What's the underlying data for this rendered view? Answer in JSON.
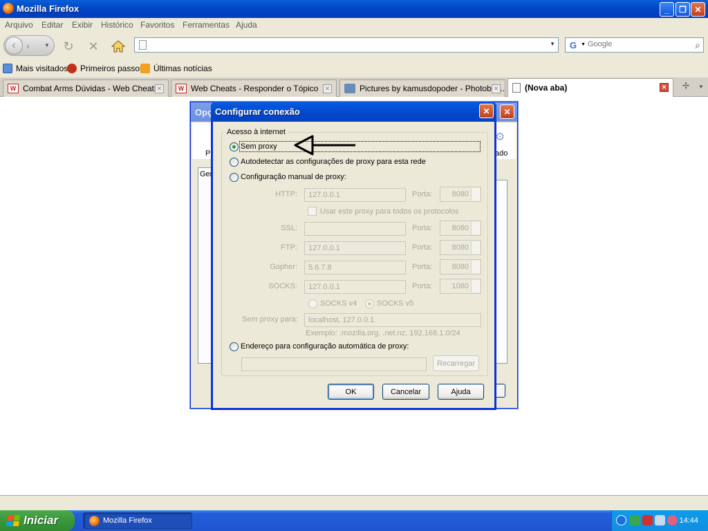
{
  "window": {
    "title": "Mozilla Firefox"
  },
  "menu": [
    "Arquivo",
    "Editar",
    "Exibir",
    "Histórico",
    "Favoritos",
    "Ferramentas",
    "Ajuda"
  ],
  "nav": {
    "url_value": "",
    "search_placeholder": "Google"
  },
  "bookmarks": [
    "Mais visitados",
    "Primeiros passos",
    "Últimas notícias"
  ],
  "tabs": [
    {
      "label": "Combat Arms Dúvidas - Web Cheats",
      "active": false
    },
    {
      "label": "Web Cheats - Responder o Tópico",
      "active": false
    },
    {
      "label": "Pictures by kamusdopoder - Photobuc...",
      "active": false
    },
    {
      "label": "(Nova aba)",
      "active": true
    }
  ],
  "options_dialog": {
    "title": "Opç",
    "toolbar_left_label": "Pr",
    "toolbar_right_label": "ado",
    "tab_label": "Gen"
  },
  "connection_dialog": {
    "title": "Configurar conexão",
    "group_label": "Acesso à internet",
    "options": [
      {
        "label": "Sem proxy",
        "checked": true
      },
      {
        "label": "Autodetectar as configurações de proxy para esta rede",
        "checked": false
      },
      {
        "label": "Configuração manual de proxy:",
        "checked": false
      }
    ],
    "proxies": [
      {
        "label": "HTTP:",
        "host": "127.0.0.1",
        "port_label": "Porta:",
        "port": "8080"
      },
      {
        "label": "SSL:",
        "host": "",
        "port_label": "Porta:",
        "port": "8080"
      },
      {
        "label": "FTP:",
        "host": "127.0.0.1",
        "port_label": "Porta:",
        "port": "8080"
      },
      {
        "label": "Gopher:",
        "host": "5.6.7.8",
        "port_label": "Porta:",
        "port": "8080"
      },
      {
        "label": "SOCKS:",
        "host": "127.0.0.1",
        "port_label": "Porta:",
        "port": "1080"
      }
    ],
    "same_proxy_label": "Usar este proxy para todos os protocolos",
    "socks_v4": "SOCKS v4",
    "socks_v5": "SOCKS v5",
    "no_proxy_label": "Sem proxy para:",
    "no_proxy_value": "localhost, 127.0.0.1",
    "example": "Exemplo: .mozilla.org, .net.nz, 192.168.1.0/24",
    "auto_config_label": "Endereço para configuração automática de proxy:",
    "auto_config_value": "",
    "reload_button": "Recarregar",
    "ok_button": "OK",
    "cancel_button": "Cancelar",
    "help_button": "Ajuda"
  },
  "taskbar": {
    "start_label": "Iniciar",
    "task_label": "Mozilla Firefox",
    "clock": "14:44"
  },
  "colors": {
    "xp_blue": "#0246c6",
    "start_green": "#3c9b3c",
    "dialog_face": "#ece9d8"
  }
}
